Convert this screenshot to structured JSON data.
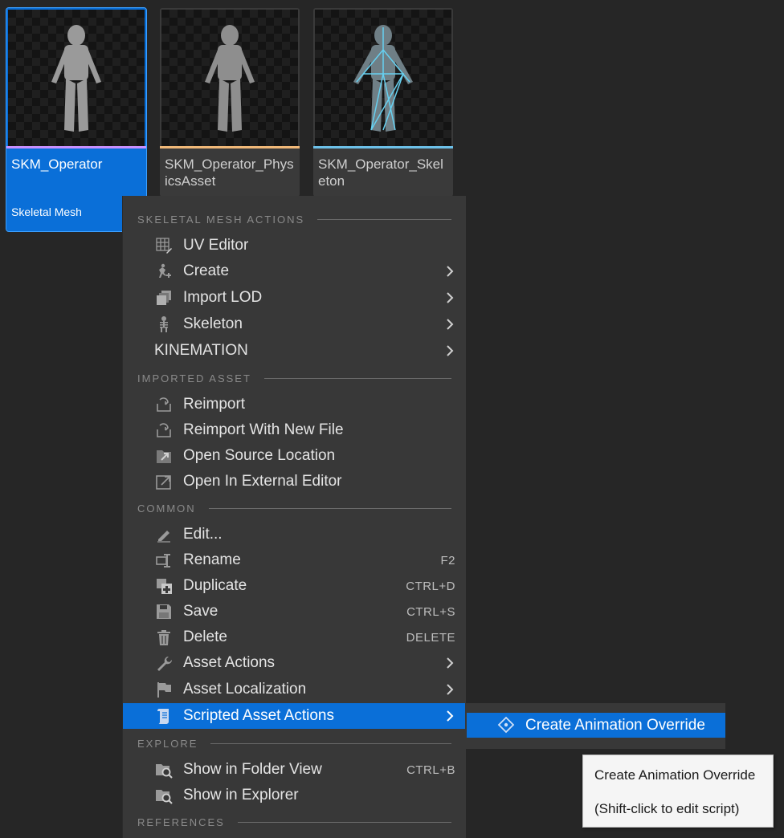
{
  "assets": [
    {
      "name": "SKM_Operator",
      "type": "Skeletal Mesh",
      "accent": "#c890ff",
      "selected": true
    },
    {
      "name": "SKM_Operator_PhysicsAsset",
      "accent": "#f0b878",
      "selected": false
    },
    {
      "name": "SKM_Operator_Skeleton",
      "accent": "#6cc0e8",
      "selected": false
    }
  ],
  "menu": {
    "sections": {
      "skeletal": "SKELETAL MESH ACTIONS",
      "imported": "IMPORTED ASSET",
      "common": "COMMON",
      "explore": "EXPLORE",
      "references": "REFERENCES"
    },
    "items": {
      "uv_editor": {
        "label": "UV Editor",
        "icon": "uv-grid-icon"
      },
      "create": {
        "label": "Create",
        "icon": "create-run-icon"
      },
      "import_lod": {
        "label": "Import LOD",
        "icon": "layers-icon"
      },
      "skeleton": {
        "label": "Skeleton",
        "icon": "skeleton-icon"
      },
      "kinemation": {
        "label": "KINEMATION"
      },
      "reimport": {
        "label": "Reimport",
        "icon": "reimport-icon"
      },
      "reimport_new": {
        "label": "Reimport With New File",
        "icon": "reimport-icon"
      },
      "open_source": {
        "label": "Open Source Location",
        "icon": "open-folder-icon"
      },
      "open_external": {
        "label": "Open In External Editor",
        "icon": "external-icon"
      },
      "edit": {
        "label": "Edit...",
        "icon": "pencil-icon"
      },
      "rename": {
        "label": "Rename",
        "shortcut": "F2",
        "icon": "rename-icon"
      },
      "duplicate": {
        "label": "Duplicate",
        "shortcut": "CTRL+D",
        "icon": "duplicate-icon"
      },
      "save": {
        "label": "Save",
        "shortcut": "CTRL+S",
        "icon": "save-icon"
      },
      "delete": {
        "label": "Delete",
        "shortcut": "DELETE",
        "icon": "trash-icon"
      },
      "asset_actions": {
        "label": "Asset Actions",
        "icon": "wrench-icon"
      },
      "asset_localization": {
        "label": "Asset Localization",
        "icon": "flag-icon"
      },
      "scripted_actions": {
        "label": "Scripted Asset Actions",
        "icon": "script-icon"
      },
      "show_folder": {
        "label": "Show in Folder View",
        "shortcut": "CTRL+B",
        "icon": "folder-search-icon"
      },
      "show_explorer": {
        "label": "Show in Explorer",
        "icon": "folder-search-icon"
      }
    }
  },
  "submenu": {
    "create_override": {
      "label": "Create Animation Override",
      "icon": "diamond-icon"
    }
  },
  "tooltip": {
    "line1": "Create Animation Override",
    "line2": "(Shift-click to edit script)"
  },
  "colors": {
    "highlight": "#0a6fd8",
    "menu_bg": "#383838",
    "background": "#262626"
  }
}
